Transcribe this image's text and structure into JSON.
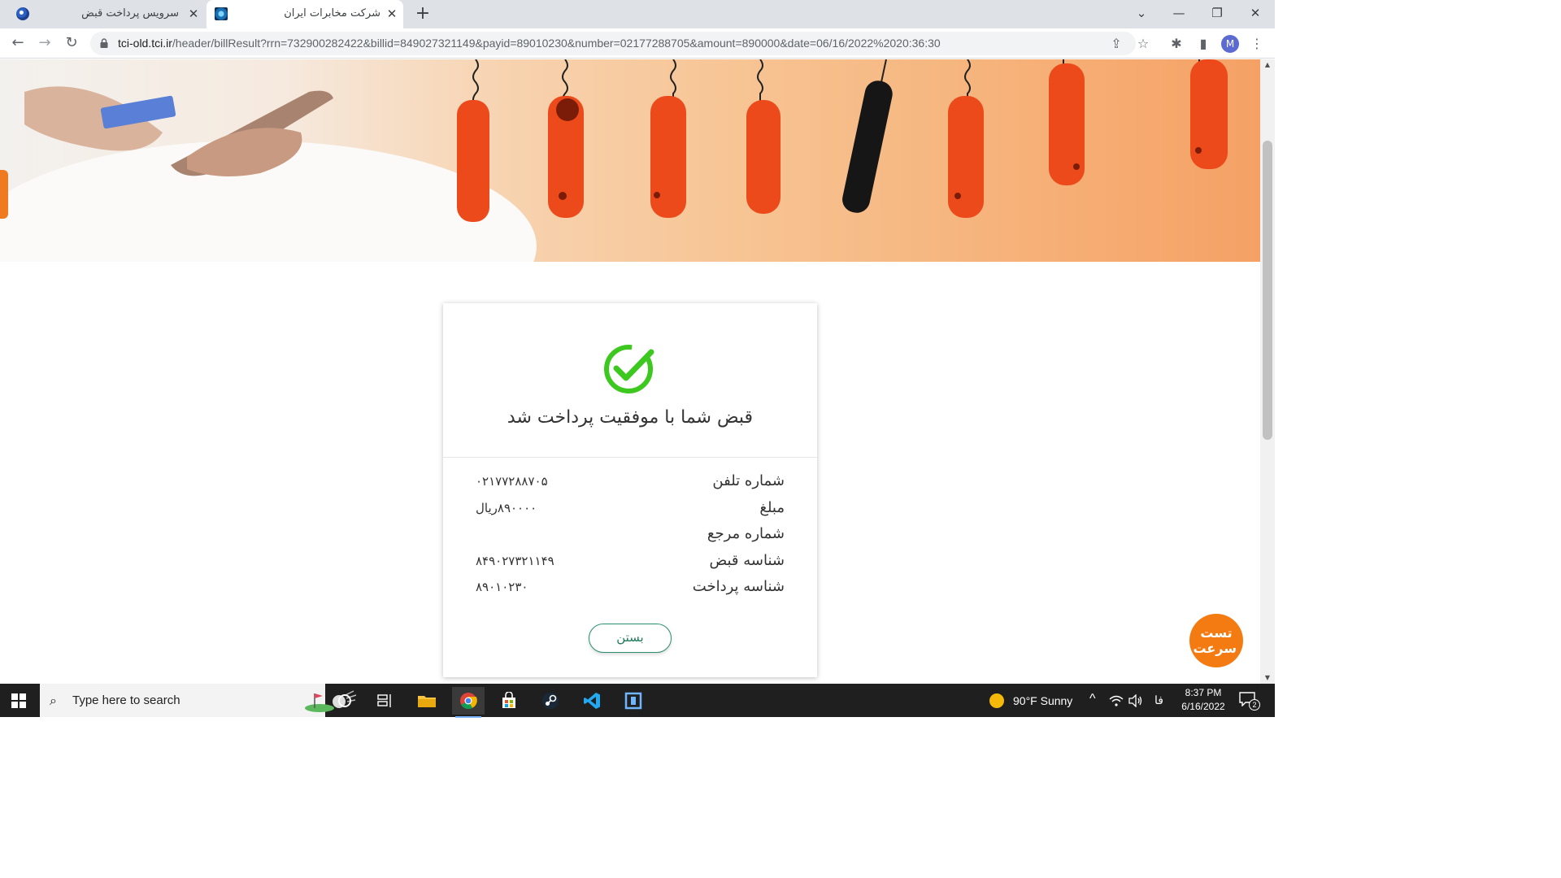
{
  "browser": {
    "tabs": [
      {
        "title": "سرویس پرداخت قبض",
        "active": false
      },
      {
        "title": "شرکت مخابرات ایران",
        "active": true
      }
    ],
    "url_host": "tci-old.tci.ir",
    "url_path": "/header/billResult?rrn=732900282422&billid=849027321149&payid=89010230&number=02177288705&amount=890000&date=06/16/2022%2020:36:30",
    "profile_initial": "M"
  },
  "receipt": {
    "title": "قبض شما با موفقیت پرداخت شد",
    "rows": [
      {
        "label": "شماره تلفن",
        "value": "۰۲۱۷۷۲۸۸۷۰۵"
      },
      {
        "label": "مبلغ",
        "value": "۸۹۰۰۰۰ریال"
      },
      {
        "label": "شماره مرجع",
        "value": ""
      },
      {
        "label": "شناسه قبض",
        "value": "۸۴۹۰۲۷۳۲۱۱۴۹"
      },
      {
        "label": "شناسه پرداخت",
        "value": "۸۹۰۱۰۲۳۰"
      }
    ],
    "close_label": "بستن",
    "success_color": "#3cc81e"
  },
  "speed_test_badge": "تست سرعت",
  "taskbar": {
    "search_placeholder": "Type here to search",
    "weather": "90°F  Sunny",
    "language": "فا",
    "time": "8:37 PM",
    "date": "6/16/2022",
    "notification_count": "2"
  }
}
